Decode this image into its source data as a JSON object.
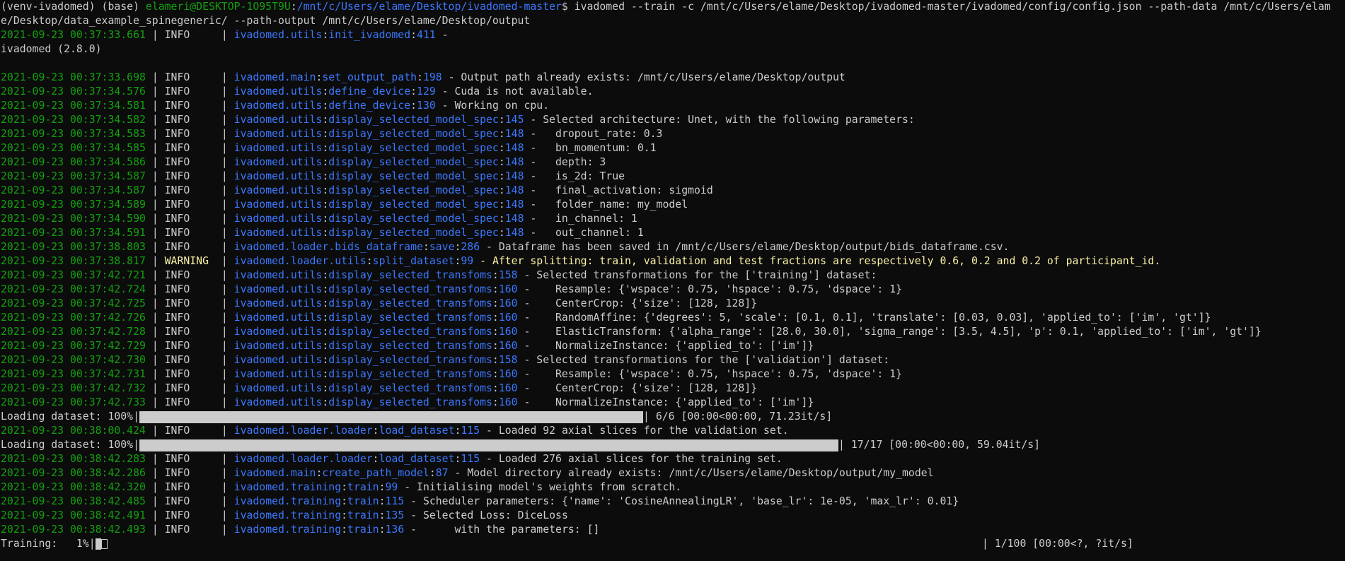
{
  "window": {
    "background": "#0c0c0c",
    "colors": {
      "timestamp": "#13a10e",
      "module": "#3b78ff",
      "warning": "#f9f1a5",
      "text": "#cccccc",
      "path": "#3b78ff"
    }
  },
  "prompt": {
    "env": "(venv-ivadomed) (base) ",
    "userhost": "elameri@DESKTOP-1O95T9U",
    "sep": ":",
    "cwd": "/mnt/c/Users/elame/Desktop/ivadomed-master",
    "dollar": "$ ",
    "command": "ivadomed --train -c /mnt/c/Users/elame/Desktop/ivadomed-master/ivadomed/config/config.json --path-data /mnt/c/Users/elam",
    "command_wrap": "e/Desktop/data_example_spinegeneric/ --path-output /mnt/c/Users/elame/Desktop/output"
  },
  "version_line": "ivadomed (2.8.0)",
  "logs": [
    {
      "ts": "2021-09-23 00:37:33.661",
      "lvl": "INFO",
      "mod": "ivadomed.utils",
      "fn": "init_ivadomed",
      "ln": "411",
      "msg": " -"
    },
    {
      "ts": "2021-09-23 00:37:33.698",
      "lvl": "INFO",
      "mod": "ivadomed.main",
      "fn": "set_output_path",
      "ln": "198",
      "msg": " - Output path already exists: /mnt/c/Users/elame/Desktop/output"
    },
    {
      "ts": "2021-09-23 00:37:34.576",
      "lvl": "INFO",
      "mod": "ivadomed.utils",
      "fn": "define_device",
      "ln": "129",
      "msg": " - Cuda is not available."
    },
    {
      "ts": "2021-09-23 00:37:34.581",
      "lvl": "INFO",
      "mod": "ivadomed.utils",
      "fn": "define_device",
      "ln": "130",
      "msg": " - Working on cpu."
    },
    {
      "ts": "2021-09-23 00:37:34.582",
      "lvl": "INFO",
      "mod": "ivadomed.utils",
      "fn": "display_selected_model_spec",
      "ln": "145",
      "msg": " - Selected architecture: Unet, with the following parameters:"
    },
    {
      "ts": "2021-09-23 00:37:34.583",
      "lvl": "INFO",
      "mod": "ivadomed.utils",
      "fn": "display_selected_model_spec",
      "ln": "148",
      "msg": " -   dropout_rate: 0.3"
    },
    {
      "ts": "2021-09-23 00:37:34.585",
      "lvl": "INFO",
      "mod": "ivadomed.utils",
      "fn": "display_selected_model_spec",
      "ln": "148",
      "msg": " -   bn_momentum: 0.1"
    },
    {
      "ts": "2021-09-23 00:37:34.586",
      "lvl": "INFO",
      "mod": "ivadomed.utils",
      "fn": "display_selected_model_spec",
      "ln": "148",
      "msg": " -   depth: 3"
    },
    {
      "ts": "2021-09-23 00:37:34.587",
      "lvl": "INFO",
      "mod": "ivadomed.utils",
      "fn": "display_selected_model_spec",
      "ln": "148",
      "msg": " -   is_2d: True"
    },
    {
      "ts": "2021-09-23 00:37:34.587",
      "lvl": "INFO",
      "mod": "ivadomed.utils",
      "fn": "display_selected_model_spec",
      "ln": "148",
      "msg": " -   final_activation: sigmoid"
    },
    {
      "ts": "2021-09-23 00:37:34.589",
      "lvl": "INFO",
      "mod": "ivadomed.utils",
      "fn": "display_selected_model_spec",
      "ln": "148",
      "msg": " -   folder_name: my_model"
    },
    {
      "ts": "2021-09-23 00:37:34.590",
      "lvl": "INFO",
      "mod": "ivadomed.utils",
      "fn": "display_selected_model_spec",
      "ln": "148",
      "msg": " -   in_channel: 1"
    },
    {
      "ts": "2021-09-23 00:37:34.591",
      "lvl": "INFO",
      "mod": "ivadomed.utils",
      "fn": "display_selected_model_spec",
      "ln": "148",
      "msg": " -   out_channel: 1"
    },
    {
      "ts": "2021-09-23 00:37:38.803",
      "lvl": "INFO",
      "mod": "ivadomed.loader.bids_dataframe",
      "fn": "save",
      "ln": "286",
      "msg": " - Dataframe has been saved in /mnt/c/Users/elame/Desktop/output/bids_dataframe.csv."
    },
    {
      "ts": "2021-09-23 00:37:38.817",
      "lvl": "WARNING",
      "mod": "ivadomed.loader.utils",
      "fn": "split_dataset",
      "ln": "99",
      "msg": " - After splitting: train, validation and test fractions are respectively 0.6, 0.2 and 0.2 of participant_id.",
      "warn": true
    },
    {
      "ts": "2021-09-23 00:37:42.721",
      "lvl": "INFO",
      "mod": "ivadomed.utils",
      "fn": "display_selected_transfoms",
      "ln": "158",
      "msg": " - Selected transformations for the ['training'] dataset:"
    },
    {
      "ts": "2021-09-23 00:37:42.724",
      "lvl": "INFO",
      "mod": "ivadomed.utils",
      "fn": "display_selected_transfoms",
      "ln": "160",
      "msg": " -    Resample: {'wspace': 0.75, 'hspace': 0.75, 'dspace': 1}"
    },
    {
      "ts": "2021-09-23 00:37:42.725",
      "lvl": "INFO",
      "mod": "ivadomed.utils",
      "fn": "display_selected_transfoms",
      "ln": "160",
      "msg": " -    CenterCrop: {'size': [128, 128]}"
    },
    {
      "ts": "2021-09-23 00:37:42.726",
      "lvl": "INFO",
      "mod": "ivadomed.utils",
      "fn": "display_selected_transfoms",
      "ln": "160",
      "msg": " -    RandomAffine: {'degrees': 5, 'scale': [0.1, 0.1], 'translate': [0.03, 0.03], 'applied_to': ['im', 'gt']}"
    },
    {
      "ts": "2021-09-23 00:37:42.728",
      "lvl": "INFO",
      "mod": "ivadomed.utils",
      "fn": "display_selected_transfoms",
      "ln": "160",
      "msg": " -    ElasticTransform: {'alpha_range': [28.0, 30.0], 'sigma_range': [3.5, 4.5], 'p': 0.1, 'applied_to': ['im', 'gt']}"
    },
    {
      "ts": "2021-09-23 00:37:42.729",
      "lvl": "INFO",
      "mod": "ivadomed.utils",
      "fn": "display_selected_transfoms",
      "ln": "160",
      "msg": " -    NormalizeInstance: {'applied_to': ['im']}"
    },
    {
      "ts": "2021-09-23 00:37:42.730",
      "lvl": "INFO",
      "mod": "ivadomed.utils",
      "fn": "display_selected_transfoms",
      "ln": "158",
      "msg": " - Selected transformations for the ['validation'] dataset:"
    },
    {
      "ts": "2021-09-23 00:37:42.731",
      "lvl": "INFO",
      "mod": "ivadomed.utils",
      "fn": "display_selected_transfoms",
      "ln": "160",
      "msg": " -    Resample: {'wspace': 0.75, 'hspace': 0.75, 'dspace': 1}"
    },
    {
      "ts": "2021-09-23 00:37:42.732",
      "lvl": "INFO",
      "mod": "ivadomed.utils",
      "fn": "display_selected_transfoms",
      "ln": "160",
      "msg": " -    CenterCrop: {'size': [128, 128]}"
    },
    {
      "ts": "2021-09-23 00:37:42.733",
      "lvl": "INFO",
      "mod": "ivadomed.utils",
      "fn": "display_selected_transfoms",
      "ln": "160",
      "msg": " -    NormalizeInstance: {'applied_to': ['im']}"
    }
  ],
  "progress1": {
    "label": "Loading dataset: 100%|",
    "fraction": 1.0,
    "tail": "| 6/6 [00:00<00:00, 71.23it/s]"
  },
  "log_after1": {
    "ts": "2021-09-23 00:38:00.424",
    "lvl": "INFO",
    "mod": "ivadomed.loader.loader",
    "fn": "load_dataset",
    "ln": "115",
    "msg": " - Loaded 92 axial slices for the validation set."
  },
  "progress2": {
    "label": "Loading dataset: 100%|",
    "fraction": 1.0,
    "tail": "| 17/17 [00:00<00:00, 59.04it/s]"
  },
  "logs2": [
    {
      "ts": "2021-09-23 00:38:42.283",
      "lvl": "INFO",
      "mod": "ivadomed.loader.loader",
      "fn": "load_dataset",
      "ln": "115",
      "msg": " - Loaded 276 axial slices for the training set."
    },
    {
      "ts": "2021-09-23 00:38:42.286",
      "lvl": "INFO",
      "mod": "ivadomed.main",
      "fn": "create_path_model",
      "ln": "87",
      "msg": " - Model directory already exists: /mnt/c/Users/elame/Desktop/output/my_model"
    },
    {
      "ts": "2021-09-23 00:38:42.320",
      "lvl": "INFO",
      "mod": "ivadomed.training",
      "fn": "train",
      "ln": "99",
      "msg": " - Initialising model's weights from scratch."
    },
    {
      "ts": "2021-09-23 00:38:42.485",
      "lvl": "INFO",
      "mod": "ivadomed.training",
      "fn": "train",
      "ln": "115",
      "msg": " - Scheduler parameters: {'name': 'CosineAnnealingLR', 'base_lr': 1e-05, 'max_lr': 0.01}"
    },
    {
      "ts": "2021-09-23 00:38:42.491",
      "lvl": "INFO",
      "mod": "ivadomed.training",
      "fn": "train",
      "ln": "135",
      "msg": " - Selected Loss: DiceLoss"
    },
    {
      "ts": "2021-09-23 00:38:42.493",
      "lvl": "INFO",
      "mod": "ivadomed.training",
      "fn": "train",
      "ln": "136",
      "msg": " -      with the parameters: []"
    }
  ],
  "training": {
    "label": "Training:   1%|",
    "fraction": 0.01,
    "tail": "| 1/100 [00:00<?, ?it/s]"
  }
}
